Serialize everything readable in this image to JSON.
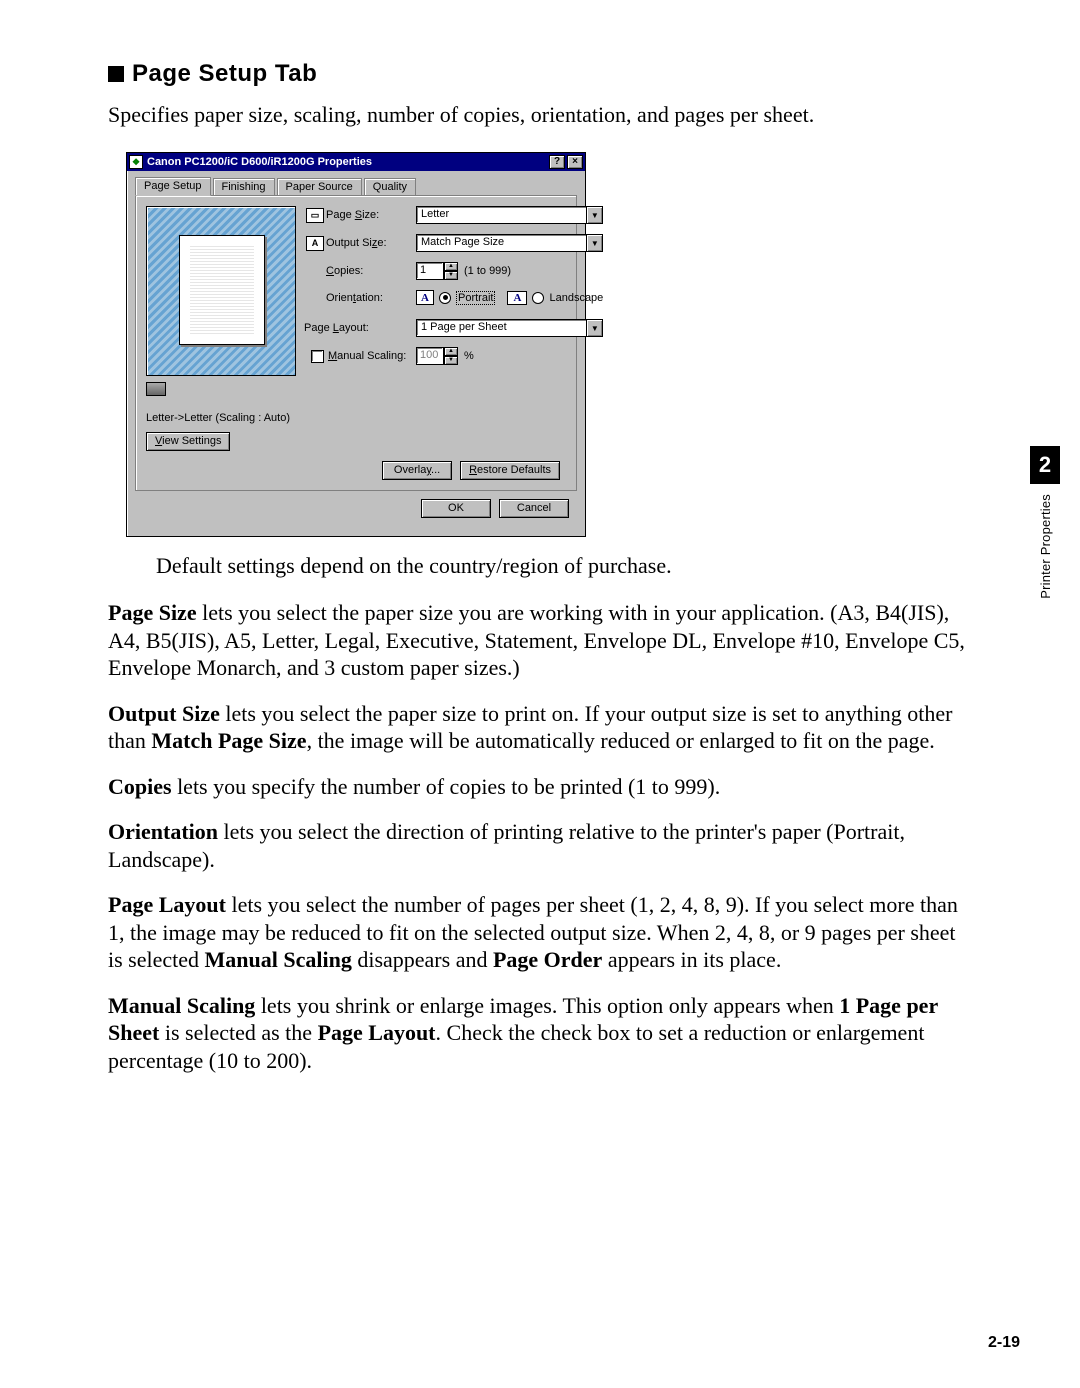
{
  "heading": "Page Setup Tab",
  "lead": "Specifies paper size, scaling, number of copies, orientation, and pages per sheet.",
  "dialog": {
    "title": "Canon PC1200/iC D600/iR1200G Properties",
    "tabs": [
      "Page Setup",
      "Finishing",
      "Paper Source",
      "Quality"
    ],
    "active_tab": 0,
    "page_size_label": "Page Size:",
    "page_size_value": "Letter",
    "output_size_label": "Output Size:",
    "output_size_value": "Match Page Size",
    "copies_label": "Copies:",
    "copies_value": "1",
    "copies_range": "(1 to 999)",
    "orientation_label": "Orientation:",
    "orientation_portrait": "Portrait",
    "orientation_landscape": "Landscape",
    "page_layout_label": "Page Layout:",
    "page_layout_value": "1 Page per Sheet",
    "manual_scaling_label": "Manual Scaling:",
    "manual_scaling_value": "100",
    "manual_scaling_unit": "%",
    "status_text": "Letter->Letter (Scaling : Auto)",
    "view_settings_btn": "View Settings",
    "overlay_btn": "Overlay...",
    "restore_btn": "Restore Defaults",
    "ok_btn": "OK",
    "cancel_btn": "Cancel"
  },
  "note": "Default settings depend on the country/region of purchase.",
  "para_page_size_pre": "Page Size",
  "para_page_size_rest": " lets you select the paper size you are working with in your application. (A3, B4(JIS), A4, B5(JIS), A5, Letter, Legal, Executive, Statement, Envelope DL, Envelope #10, Envelope C5, Envelope Monarch, and 3 custom paper sizes.)",
  "para_output_pre": "Output Size",
  "para_output_mid1": " lets you select the paper size to print on. If your output size is set to anything other than ",
  "para_output_bold2": "Match Page Size",
  "para_output_mid2": ", the image will be automatically reduced or enlarged to fit on the page.",
  "para_copies_pre": "Copies",
  "para_copies_rest": " lets you specify the number of copies to be printed (1 to 999).",
  "para_orient_pre": "Orientation",
  "para_orient_rest": " lets you select the direction of printing relative to the printer's paper (Portrait, Landscape).",
  "para_layout_pre": "Page Layout",
  "para_layout_mid1": " lets you select the number of pages per sheet (1, 2, 4, 8, 9). If you select more than 1, the image may be reduced to fit on the selected output size. When 2, 4, 8, or 9 pages per sheet is selected ",
  "para_layout_bold2": "Manual Scaling",
  "para_layout_mid2": " disappears and ",
  "para_layout_bold3": "Page Order",
  "para_layout_mid3": " appears in its place.",
  "para_manual_pre": "Manual Scaling",
  "para_manual_mid1": " lets you shrink or enlarge images. This option only appears when ",
  "para_manual_bold2": "1 Page per Sheet",
  "para_manual_mid2": " is selected as the ",
  "para_manual_bold3": "Page Layout",
  "para_manual_mid3": ". Check the check box to set a reduction or enlargement percentage (10 to 200).",
  "side_chapter": "2",
  "side_label": "Printer Properties",
  "page_number": "2-19"
}
